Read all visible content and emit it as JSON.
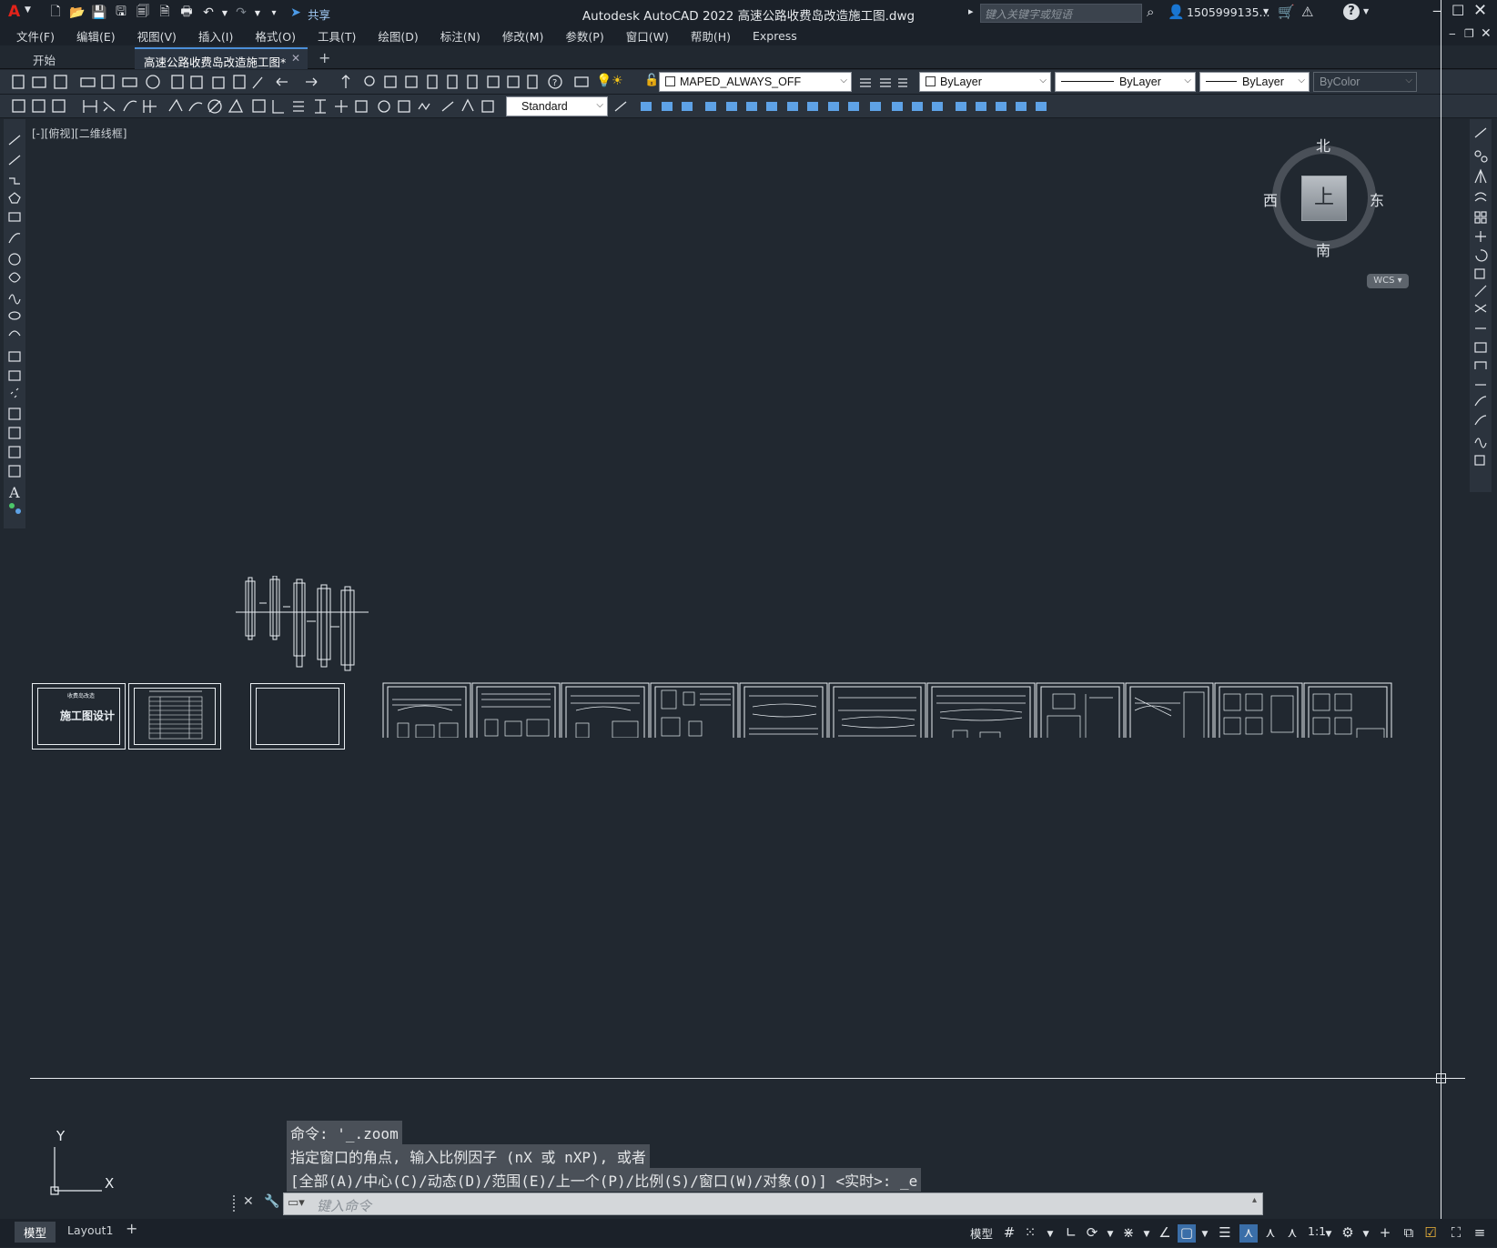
{
  "app": {
    "window_title": "Autodesk AutoCAD 2022    高速公路收费岛改造施工图.dwg",
    "logo": "A",
    "share_label": "共享",
    "search_placeholder": "键入关键字或短语",
    "user": "1505999135...",
    "window_controls": [
      "minimize-icon",
      "maximize-icon",
      "close-icon"
    ]
  },
  "menu": [
    "文件(F)",
    "编辑(E)",
    "视图(V)",
    "插入(I)",
    "格式(O)",
    "工具(T)",
    "绘图(D)",
    "标注(N)",
    "修改(M)",
    "参数(P)",
    "窗口(W)",
    "帮助(H)",
    "Express"
  ],
  "tabs": [
    {
      "label": "开始"
    },
    {
      "label": "高速公路收费岛改造施工图*"
    }
  ],
  "toolbar": {
    "layer_name": "MAPED_ALWAYS_OFF",
    "color": "ByLayer",
    "linetype": "ByLayer",
    "lineweight": "ByLayer",
    "plotstyle": "ByColor",
    "textstyle": "Standard"
  },
  "viewport": {
    "label": "[-][俯视][二维线框]",
    "viewcube": {
      "north": "北",
      "south": "南",
      "east": "东",
      "west": "西",
      "top": "上",
      "wcs": "WCS"
    },
    "ucs": {
      "x": "X",
      "y": "Y"
    },
    "title_sheet_small": "收费岛改造",
    "title_sheet_main": "施工图设计"
  },
  "command": {
    "history": [
      "命令: '_.zoom",
      "指定窗口的角点, 输入比例因子 (nX 或 nXP), 或者",
      "[全部(A)/中心(C)/动态(D)/范围(E)/上一个(P)/比例(S)/窗口(W)/对象(O)] <实时>: _e"
    ],
    "placeholder": "键入命令"
  },
  "layout_tabs": [
    "模型",
    "Layout1"
  ],
  "status": {
    "model_label": "模型",
    "scale": "1:1"
  },
  "colors": {
    "background": "#212830",
    "toolbar": "#2b333d",
    "accent": "#4c8fd8",
    "lines": "#e9eef2"
  }
}
